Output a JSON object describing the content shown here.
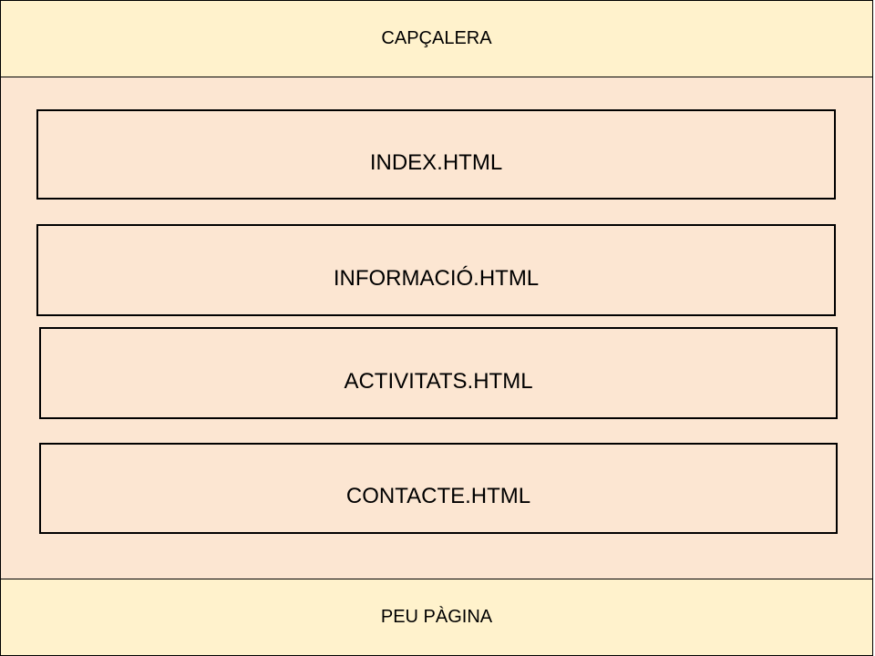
{
  "colors": {
    "header_fill": "#FFF2CC",
    "body_fill": "#FCE6D2",
    "footer_fill": "#FFF2CC",
    "border": "#000000"
  },
  "header": {
    "label": "CAPÇALERA"
  },
  "pages": [
    {
      "label": "INDEX.HTML"
    },
    {
      "label": "INFORMACIÓ.HTML"
    },
    {
      "label": "ACTIVITATS.HTML"
    },
    {
      "label": "CONTACTE.HTML"
    }
  ],
  "footer": {
    "label": "PEU PÀGINA"
  }
}
